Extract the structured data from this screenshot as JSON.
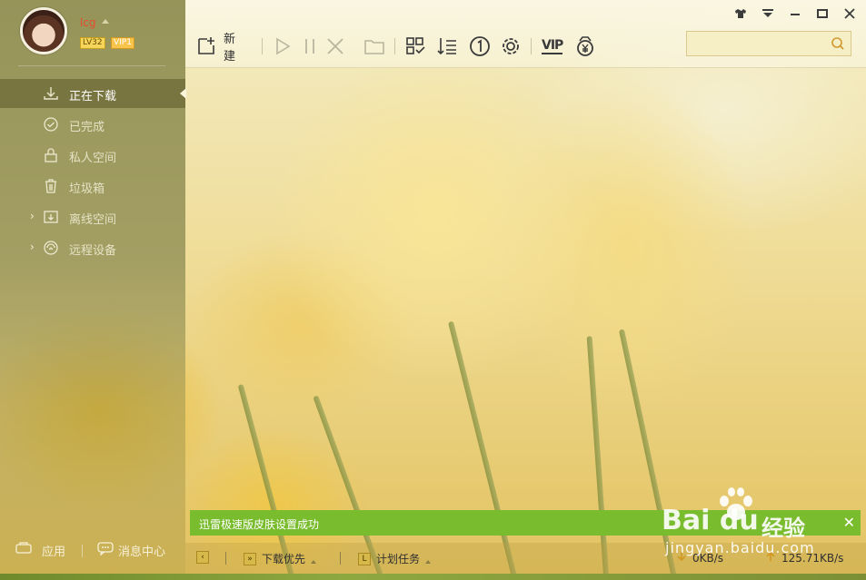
{
  "profile": {
    "username": "lcg",
    "level": "LV32",
    "vip": "VIP1"
  },
  "sidebar": {
    "items": [
      {
        "label": "正在下载",
        "icon": "download-icon",
        "active": true
      },
      {
        "label": "已完成",
        "icon": "check-circle-icon",
        "active": false
      },
      {
        "label": "私人空间",
        "icon": "lock-icon",
        "active": false
      },
      {
        "label": "垃圾箱",
        "icon": "trash-icon",
        "active": false
      },
      {
        "label": "离线空间",
        "icon": "cloud-download-icon",
        "active": false,
        "expandable": true
      },
      {
        "label": "远程设备",
        "icon": "remote-device-icon",
        "active": false,
        "expandable": true
      }
    ],
    "footer": {
      "apps_label": "应用",
      "messages_label": "消息中心"
    }
  },
  "toolbar": {
    "new_label": "新建",
    "vip_label": "VIP",
    "buttons": [
      "new-task",
      "start",
      "pause",
      "delete",
      "open-folder",
      "view-grid",
      "sort",
      "limit-one",
      "settings",
      "vip",
      "coin"
    ]
  },
  "search": {
    "value": "",
    "placeholder": ""
  },
  "toast": {
    "message": "迅雷极速版皮肤设置成功"
  },
  "statusbar": {
    "priority_label": "下载优先",
    "schedule_label": "计划任务",
    "download_speed": "0KB/s",
    "upload_speed": "125.71KB/s"
  },
  "watermark": {
    "brand": "Bai du",
    "cn": "经验",
    "url": "jingyan.baidu.com"
  },
  "colors": {
    "accent_green": "#79bc2d",
    "username_red": "#e84c2e",
    "sidebar_active": "#6e6937"
  }
}
